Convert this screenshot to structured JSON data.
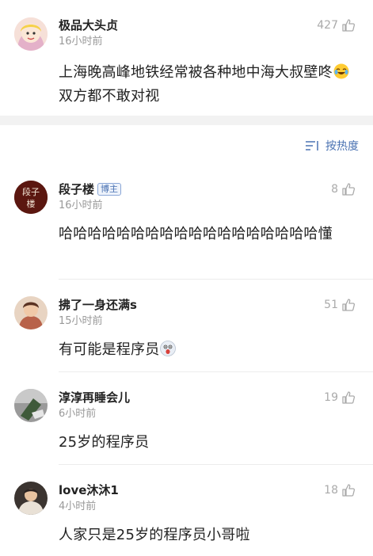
{
  "top_comment": {
    "name": "极品大头贞",
    "time": "16小时前",
    "likes": "427",
    "text_before_emoji": "上海晚高峰地铁经常被各种地中海大叔壁咚",
    "text_after_emoji": "双方都不敢对视",
    "emoji": "crying-laughing-emoji"
  },
  "sort": {
    "label": "按热度",
    "icon": "sort-lines-icon"
  },
  "replies": [
    {
      "name": "段子楼",
      "badge": "博主",
      "time": "16小时前",
      "likes": "8",
      "text": "哈哈哈哈哈哈哈哈哈哈哈哈哈哈哈哈哈哈懂"
    },
    {
      "name": "拂了一身还满s",
      "time": "15小时前",
      "likes": "51",
      "text": "有可能是程序员",
      "emoji": "shocked-emoji"
    },
    {
      "name": "淳淳再睡会儿",
      "time": "6小时前",
      "likes": "19",
      "text": "25岁的程序员"
    },
    {
      "name": "love沐沐1",
      "time": "4小时前",
      "likes": "18",
      "text": "人家只是25岁的程序员小哥啦"
    }
  ],
  "colors": {
    "accent": "#4a72b2",
    "muted": "#999999",
    "divider": "#ececec",
    "band": "#f2f2f2"
  }
}
